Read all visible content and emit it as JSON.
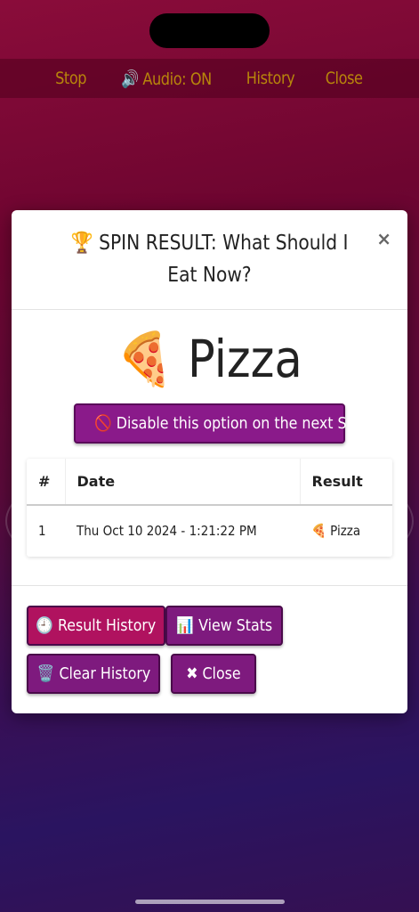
{
  "topbar": {
    "items": [
      "Stop",
      "🔊 Audio: ON",
      "History",
      "Close"
    ]
  },
  "modal": {
    "title": "🏆 SPIN RESULT: What Should I Eat Now?",
    "close_symbol": "×",
    "result": "🍕 Pizza",
    "disable_button": "🚫 Disable this option on the next Spin",
    "table": {
      "headers": [
        "#",
        "Date",
        "Result"
      ],
      "rows": [
        {
          "num": "1",
          "date": "Thu Oct 10 2024 - 1:21:22 PM",
          "result": "🍕 Pizza"
        }
      ]
    },
    "footer": {
      "result_history": "🕘 Result History",
      "view_stats": "📊 View Stats",
      "clear_history": "🗑️ Clear History",
      "close": "✖ Close"
    }
  }
}
